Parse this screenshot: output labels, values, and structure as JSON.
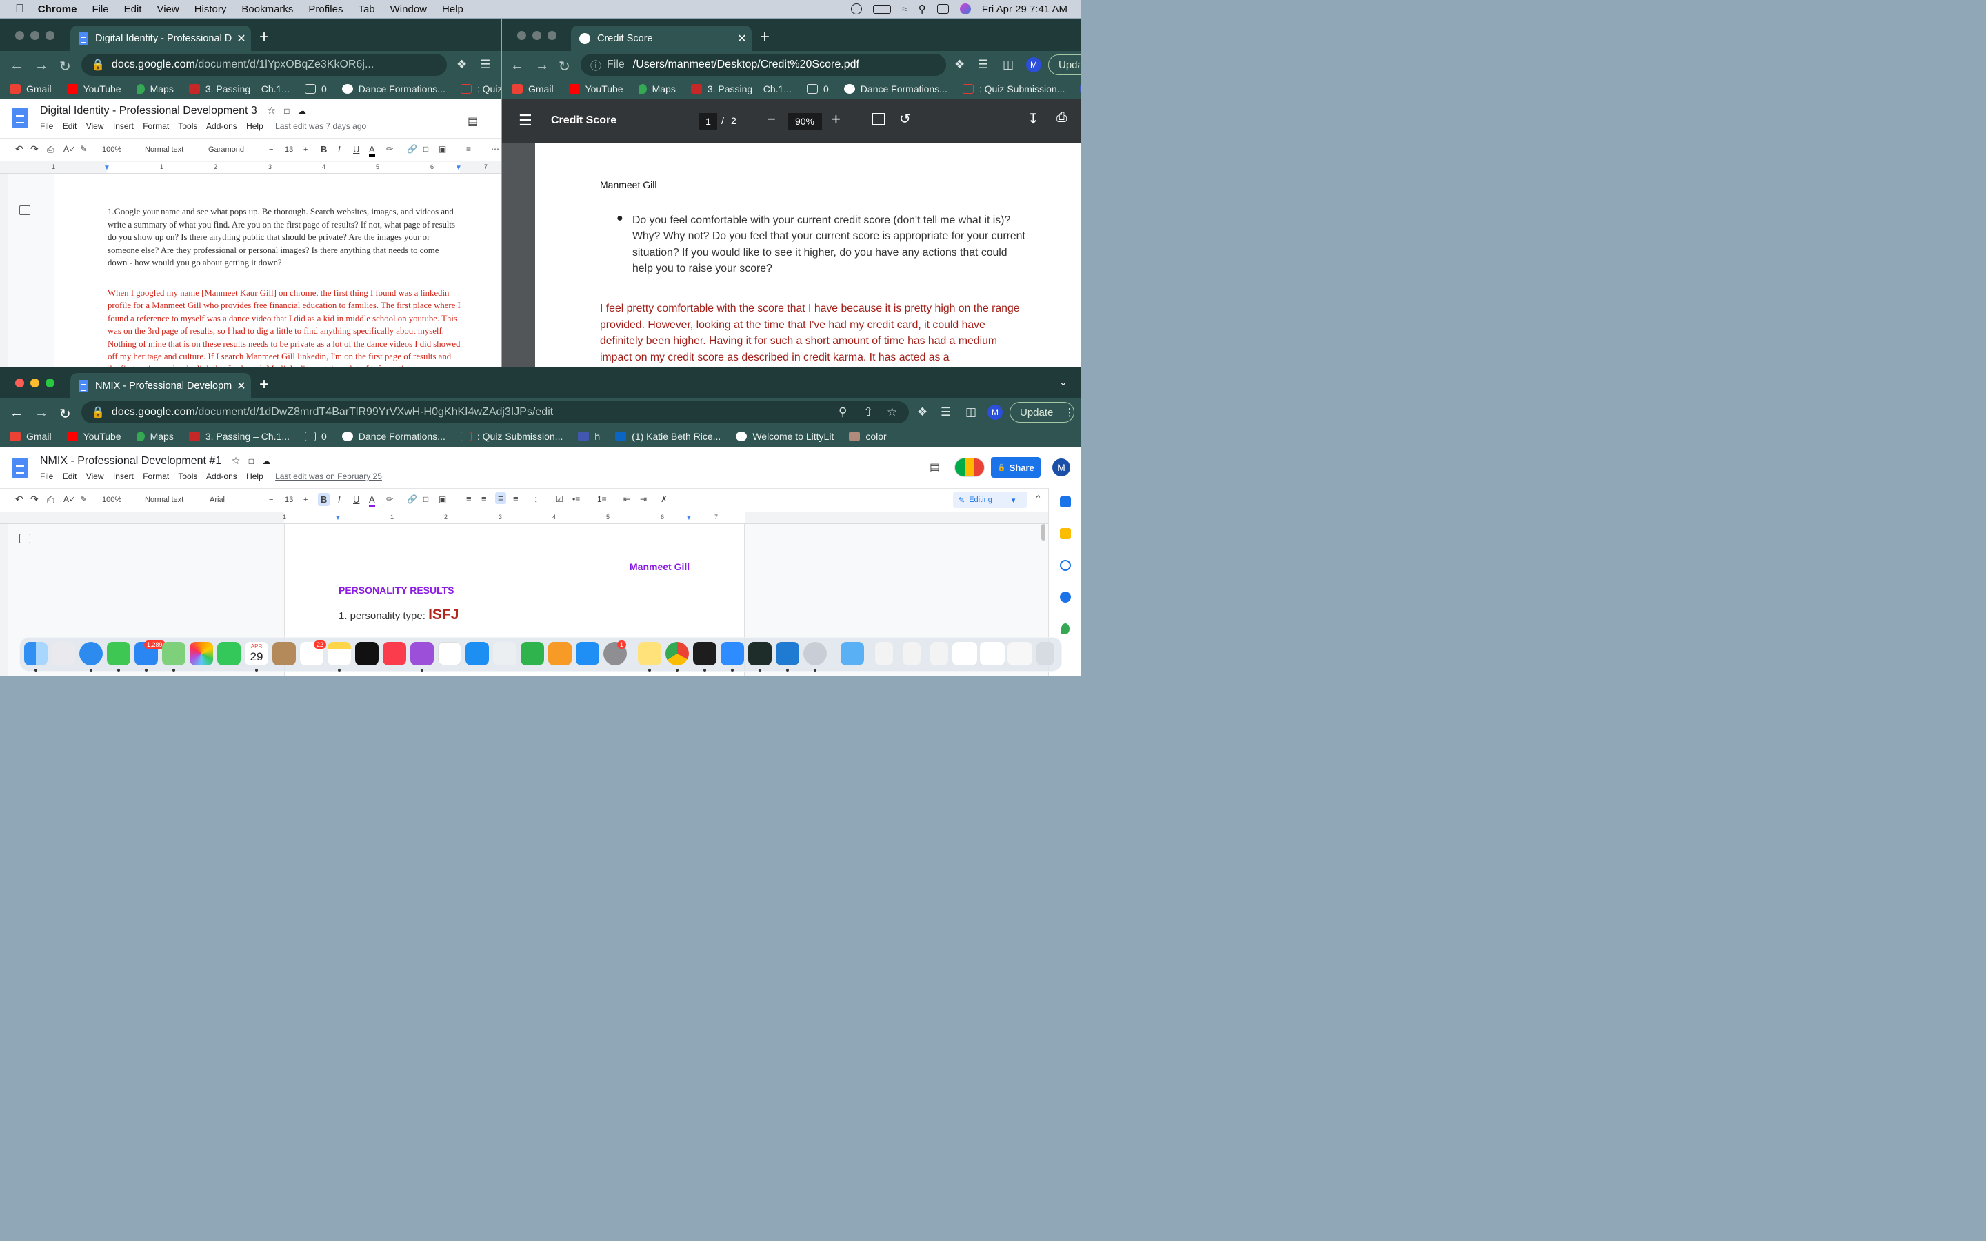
{
  "menubar": {
    "app": "Chrome",
    "items": [
      "File",
      "Edit",
      "View",
      "History",
      "Bookmarks",
      "Profiles",
      "Tab",
      "Window",
      "Help"
    ],
    "datetime": "Fri Apr 29  7:41 AM"
  },
  "bookmarks_short": [
    "Gmail",
    "YouTube",
    "Maps",
    "3. Passing – Ch.1...",
    "0",
    "Dance Formations...",
    ": Quiz Su"
  ],
  "bookmarks_full": [
    "Gmail",
    "YouTube",
    "Maps",
    "3. Passing – Ch.1...",
    "0",
    "Dance Formations...",
    ": Quiz Submission...",
    "h",
    "(1) Katie Beth Rice...",
    "Welcome to LittyLit",
    "color"
  ],
  "bookmarks_pdf": [
    "Gmail",
    "YouTube",
    "Maps",
    "3. Passing – Ch.1...",
    "0",
    "Dance Formations...",
    ": Quiz Submission...",
    "h"
  ],
  "doc_menus": [
    "File",
    "Edit",
    "View",
    "Insert",
    "Format",
    "Tools",
    "Add-ons",
    "Help"
  ],
  "win1": {
    "tab_title": "Digital Identity - Professional D",
    "url_host": "docs.google.com",
    "url_path": "/document/d/1lYpxOBqZe3KkOR6j...",
    "doc_title": "Digital Identity - Professional Development 3",
    "last_edit": "Last edit was 7 days ago",
    "zoom": "100%",
    "style": "Normal text",
    "font": "Garamond",
    "size": "13",
    "question": "1.Google your name and see what pops up. Be thorough. Search websites, images, and videos and write a summary of what you find. Are you on the first page of results? If not, what page of results do you show up on? Is there anything public that should be private? Are the images your or someone else? Are they professional or personal images? Is there anything that needs to come down - how would you go about getting it down?",
    "answer": "When I googled my name [Manmeet Kaur Gill] on chrome, the first thing I found was a linkedin profile for a Manmeet Gill who provides free financial education to families. The first place where I found a reference to myself was a dance video that I did as a kid in middle school on youtube. This was on the 3rd page of results, so I had to dig a little to find anything specifically about myself. Nothing of mine that is on these results needs to be private as a lot of the dance videos I did showed off my heritage and culture. If I search Manmeet Gill linkedin, I'm on the first page of results and the first option under the link that I selected. My linkedin contains a lot of information on my qualifications and skills as a"
  },
  "win2": {
    "tab_title": "Credit Score",
    "url_scheme": "File",
    "url_path": "/Users/manmeet/Desktop/Credit%20Score.pdf",
    "update_label": "Upda",
    "pdf_title": "Credit Score",
    "page_current": "1",
    "page_total": "2",
    "zoom": "90%",
    "author": "Manmeet Gill",
    "bullet": "Do you feel comfortable with your current credit score (don't tell me what it is)? Why? Why not? Do you feel that your current score is appropriate for your current situation? If you would like to see it higher, do you have any actions that could help you to raise your score?",
    "answer": "I feel pretty comfortable with the score that I have because it is pretty high on the range provided. However, looking at the time that I've had my credit card, it could have definitely been higher.  Having it for such a short amount of time has had a medium impact on my credit score as described in credit karma. It has acted as a"
  },
  "win3": {
    "tab_title": "NMIX - Professional Developme",
    "url_host": "docs.google.com",
    "url_path": "/document/d/1dDwZ8mrdT4BarTlR99YrVXwH-H0gKhKI4wZAdj3IJPs/edit",
    "update_label": "Update",
    "doc_title": "NMIX - Professional Development #1",
    "last_edit": "Last edit was on February 25",
    "share_label": "Share",
    "editing_label": "Editing",
    "zoom": "100%",
    "style": "Normal text",
    "font": "Arial",
    "size": "13",
    "name": "Manmeet Gill",
    "heading": "PERSONALITY RESULTS",
    "item_prefix": "1. personality type: ",
    "item_value": "ISFJ"
  },
  "ruler_labels": [
    "1",
    "1",
    "2",
    "3",
    "4",
    "5",
    "6",
    "7"
  ],
  "dock": {
    "calendar_month": "APR",
    "calendar_day": "29",
    "mail_badge": "1,289",
    "reminders_badge": "22",
    "settings_badge": "1"
  },
  "avatar_letter": "M",
  "colors": {
    "chrome_frame": "#1f3a38",
    "chrome_toolbar": "#2f5451",
    "answer_red": "#d0281c",
    "pdf_red": "#a3201a",
    "purple": "#8a1be0",
    "isfj": "#b3261e",
    "docs_blue": "#1a73e8"
  }
}
